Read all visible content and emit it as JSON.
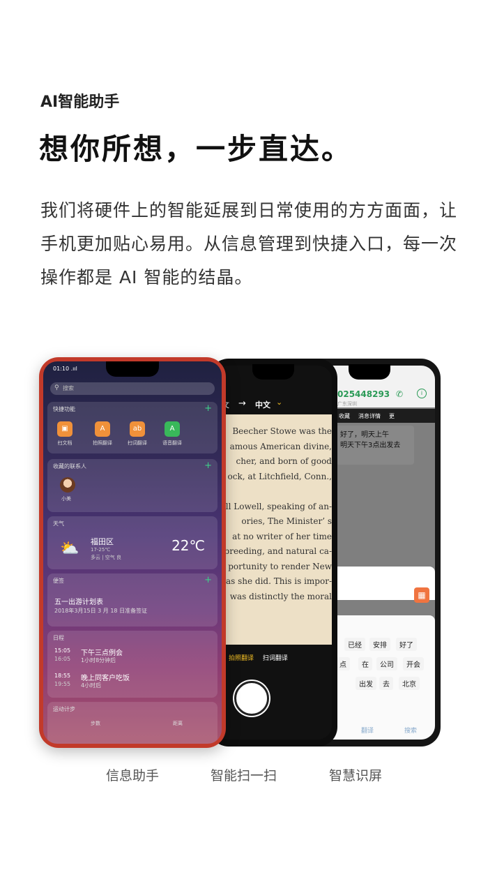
{
  "header": {
    "eyebrow": "AI智能助手",
    "headline": "想你所想，一步直达。",
    "body": "我们将硬件上的智能延展到日常使用的方方面面，让手机更加贴心易用。从信息管理到快捷入口，每一次操作都是 AI 智能的结晶。"
  },
  "phone_left": {
    "status_time": "01:10",
    "search_placeholder": "搜索",
    "quick": {
      "title": "快捷功能",
      "items": [
        "扫文档",
        "拍照翻译",
        "扫词翻译",
        "语音翻译"
      ]
    },
    "contacts": {
      "title": "收藏的联系人",
      "name": "小美"
    },
    "weather": {
      "title": "天气",
      "location": "福田区",
      "range": "17-25℃",
      "desc": "多云 | 空气 良",
      "temp": "22℃"
    },
    "notes": {
      "title": "便签",
      "note_title": "五一出游计划表",
      "note_desc": "2018年3月15日  3 月 18 日准备签证"
    },
    "schedule": {
      "title": "日程",
      "events": [
        {
          "start": "15:05",
          "end": "16:05",
          "name": "下午三点例会",
          "duration": "1小时8分钟后"
        },
        {
          "start": "18:55",
          "end": "19:55",
          "name": "晚上同客户吃饭",
          "duration": "4小时后"
        }
      ]
    },
    "steps": {
      "title": "运动计步",
      "steps_label": "步数",
      "distance_label": "距离"
    }
  },
  "phone_middle": {
    "lang_from": "文",
    "arrow": "→",
    "lang_to": "中文",
    "book_lines": [
      "Beecher Stowe was the",
      "amous American divine,",
      "cher, and born of good",
      "ock, at Litchfield, Conn.,",
      "",
      "ell Lowell, speaking of an-",
      "ories, The Minister’ s",
      "at no writer of her time",
      "breeding, and natural ca-",
      "portunity to render New",
      "as she did. This is impor-",
      "was distinctly the moral"
    ],
    "mode_active": "拍照翻译",
    "mode_other": "扫词翻译"
  },
  "phone_right": {
    "number": "025448293",
    "subtitle": "广东深圳",
    "tabs": [
      "收藏",
      "消息详情",
      "更"
    ],
    "bubble_lines": [
      "好了，明天上午",
      "明天下午3点出发去"
    ],
    "chips": [
      "已经",
      "安排",
      "好了",
      "点",
      "在",
      "公司",
      "开会",
      "出发",
      "去",
      "北京"
    ],
    "bottom": [
      "翻译",
      "搜索"
    ]
  },
  "captions": [
    "信息助手",
    "智能扫一扫",
    "智慧识屏"
  ],
  "colors": {
    "accent_green": "#2a9a56",
    "phone_red": "#c23a2a",
    "camera_yellow": "#f4c025",
    "calendar_orange": "#f07440"
  }
}
